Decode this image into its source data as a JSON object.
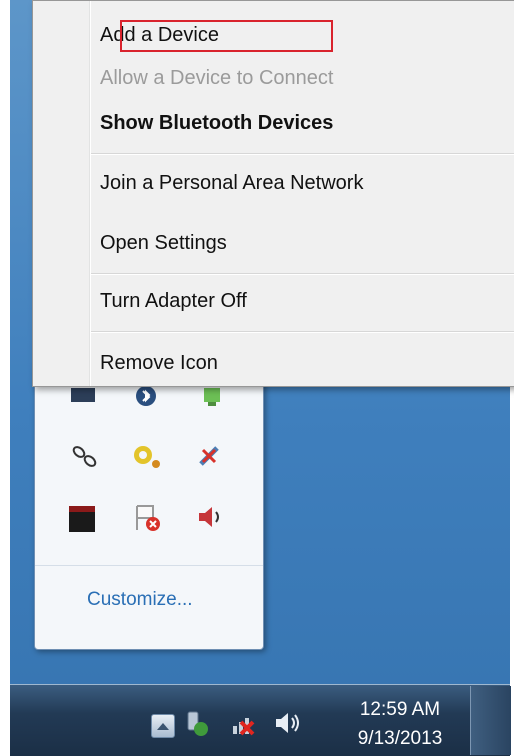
{
  "context_menu": {
    "items": [
      {
        "label": "Add a Device",
        "state": "highlighted"
      },
      {
        "label": "Allow a Device to Connect",
        "state": "disabled"
      },
      {
        "label": "Show Bluetooth Devices",
        "state": "default-bold"
      },
      {
        "label": "Join a Personal Area Network",
        "state": "normal"
      },
      {
        "label": "Open Settings",
        "state": "normal"
      },
      {
        "label": "Turn Adapter Off",
        "state": "normal"
      },
      {
        "label": "Remove Icon",
        "state": "normal"
      }
    ],
    "highlight_color": "#d9232d"
  },
  "tray_overflow": {
    "icons": [
      "monitor-icon",
      "bluetooth-icon",
      "network-status-icon",
      "chain-link-icon",
      "gear-utility-icon",
      "network-disconnected-icon",
      "black-app-icon",
      "action-center-flag-icon",
      "speaker-icon"
    ],
    "customize_label": "Customize..."
  },
  "taskbar": {
    "icons": [
      "show-hidden-icons-icon",
      "bluetooth-tray-icon",
      "network-error-icon",
      "volume-icon"
    ],
    "time": "12:59 AM",
    "date": "9/13/2013"
  },
  "colors": {
    "desktop": "#3f7fbd",
    "taskbar": "#223a55",
    "link": "#2a6fb5"
  }
}
